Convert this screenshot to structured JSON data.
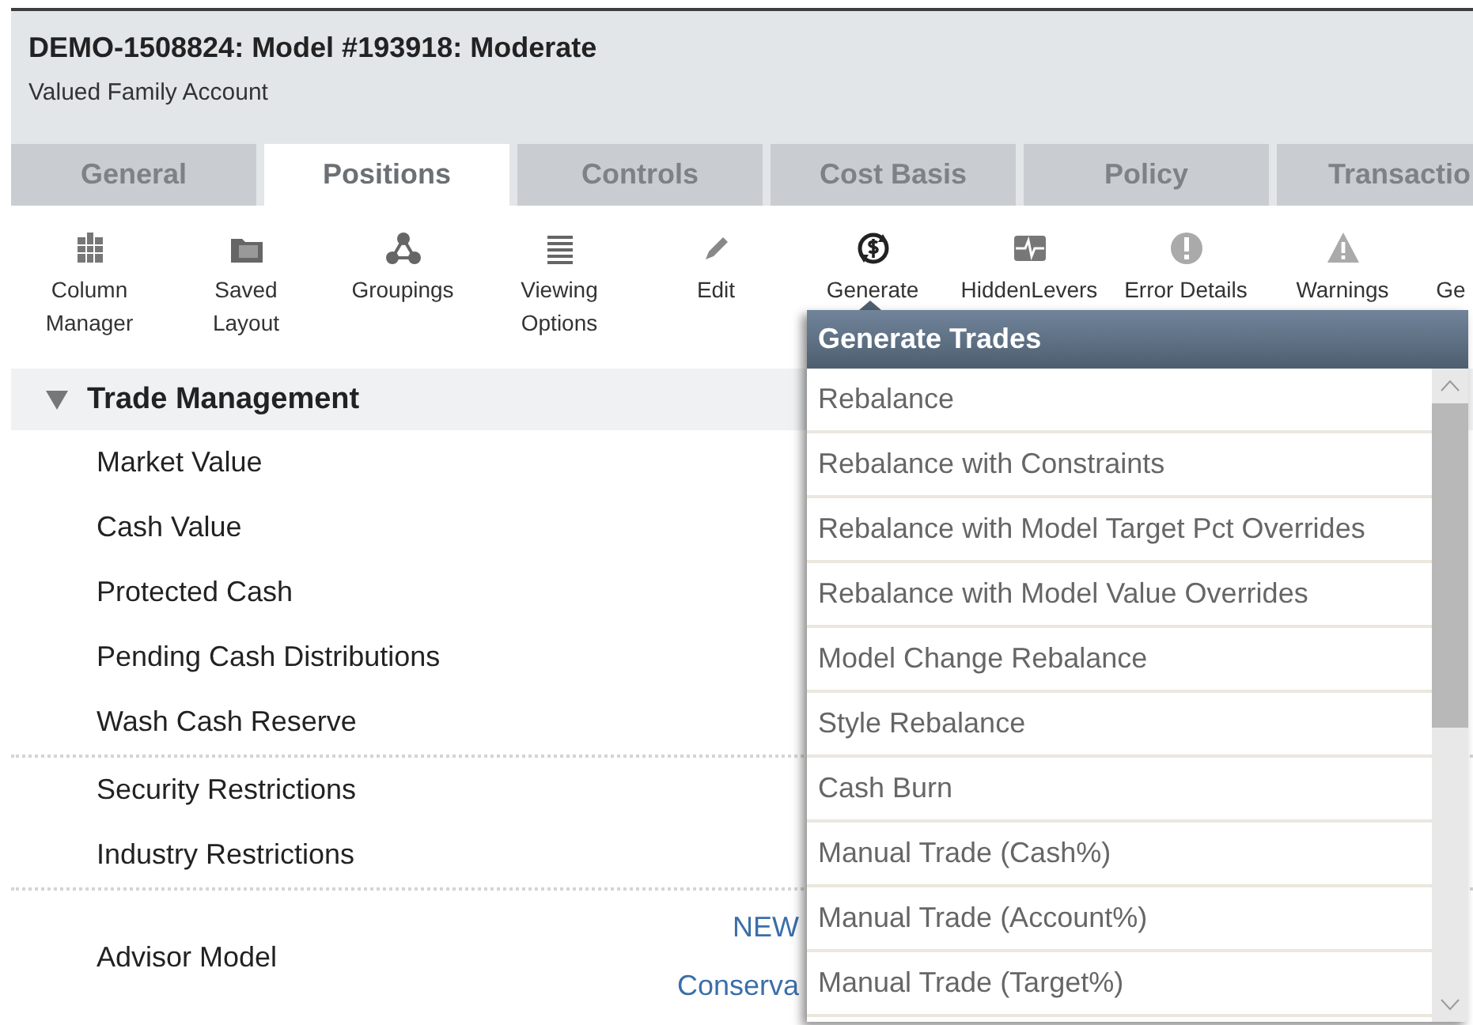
{
  "header": {
    "title": "DEMO-1508824: Model #193918: Moderate",
    "subtitle": "Valued Family Account"
  },
  "tabs": [
    {
      "label": "General",
      "selected": false
    },
    {
      "label": "Positions",
      "selected": true
    },
    {
      "label": "Controls",
      "selected": false
    },
    {
      "label": "Cost Basis",
      "selected": false
    },
    {
      "label": "Policy",
      "selected": false
    },
    {
      "label": "Transactio",
      "selected": false
    }
  ],
  "toolbar": [
    {
      "lines": [
        "Column",
        "Manager"
      ]
    },
    {
      "lines": [
        "Saved",
        "Layout"
      ]
    },
    {
      "lines": [
        "Groupings"
      ]
    },
    {
      "lines": [
        "Viewing",
        "Options"
      ]
    },
    {
      "lines": [
        "Edit"
      ]
    },
    {
      "lines": [
        "Generate"
      ]
    },
    {
      "lines": [
        "HiddenLevers"
      ]
    },
    {
      "lines": [
        "Error Details"
      ]
    },
    {
      "lines": [
        "Warnings"
      ]
    },
    {
      "lines": [
        "Ge"
      ]
    }
  ],
  "section": {
    "title": "Trade Management",
    "expanded": true,
    "groups": [
      [
        {
          "label": "Market Value"
        },
        {
          "label": "Cash Value"
        },
        {
          "label": "Protected Cash"
        },
        {
          "label": "Pending Cash Distributions"
        },
        {
          "label": "Wash Cash Reserve"
        }
      ],
      [
        {
          "label": "Security Restrictions"
        },
        {
          "label": "Industry Restrictions"
        }
      ],
      [
        {
          "label": "Advisor Model",
          "values": [
            "NEW",
            "Conserva"
          ]
        }
      ]
    ]
  },
  "dropdown": {
    "title": "Generate Trades",
    "items": [
      "Rebalance",
      "Rebalance with Constraints",
      "Rebalance with Model Target Pct Overrides",
      "Rebalance with Model Value Overrides",
      "Model Change Rebalance",
      "Style Rebalance",
      "Cash Burn",
      "Manual Trade (Cash%)",
      "Manual Trade (Account%)",
      "Manual Trade (Target%)"
    ]
  }
}
